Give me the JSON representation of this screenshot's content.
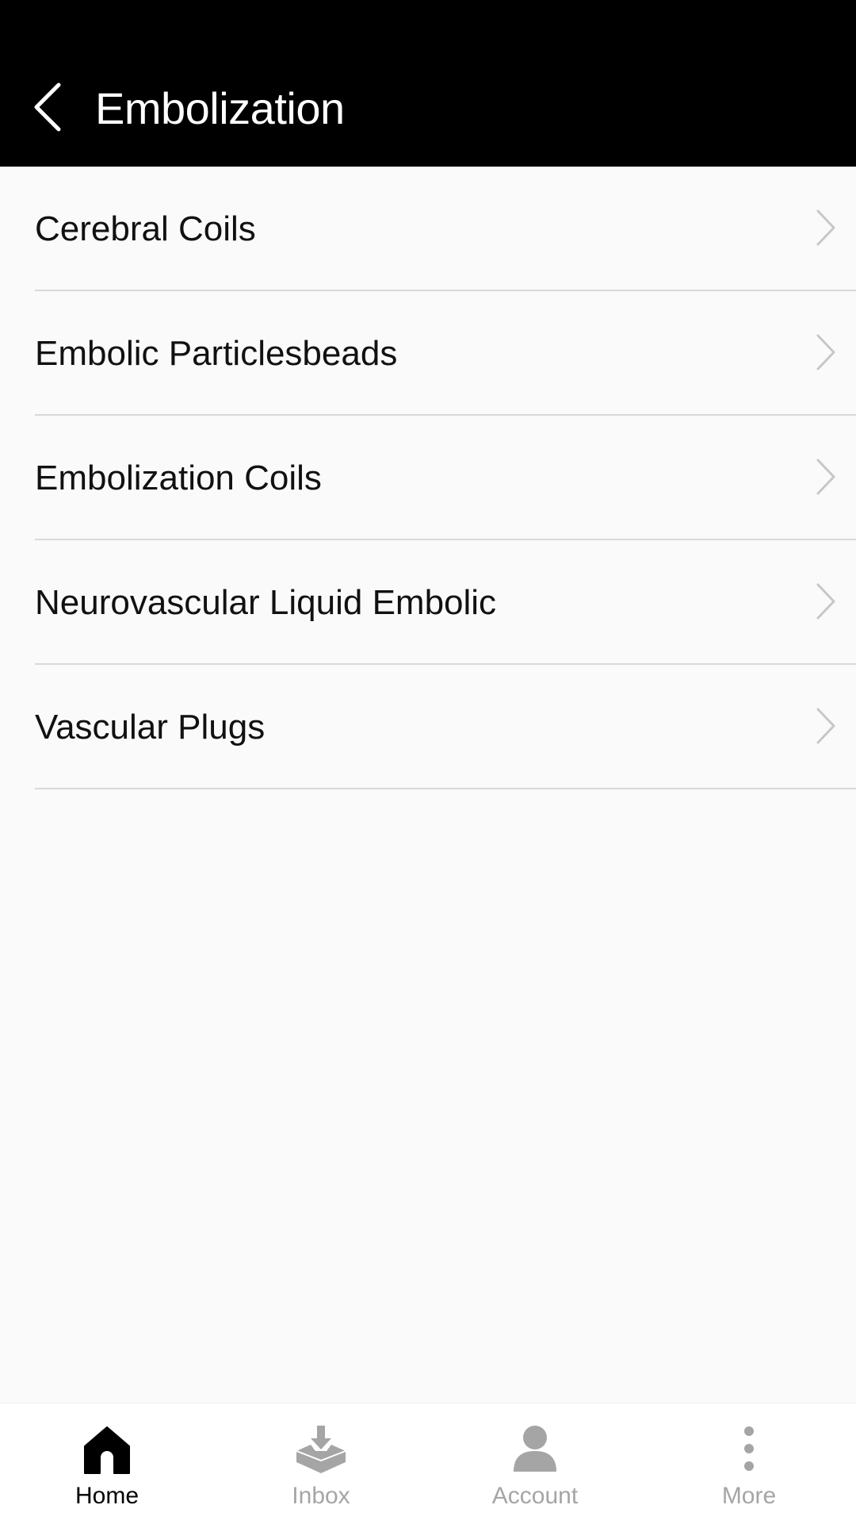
{
  "header": {
    "title": "Embolization",
    "back_icon": "chevron-left-icon"
  },
  "list": {
    "items": [
      {
        "label": "Cerebral Coils"
      },
      {
        "label": "Embolic Particlesbeads"
      },
      {
        "label": "Embolization Coils"
      },
      {
        "label": "Neurovascular Liquid Embolic"
      },
      {
        "label": "Vascular Plugs"
      }
    ],
    "chevron_icon": "chevron-right-icon"
  },
  "tabbar": {
    "tabs": [
      {
        "label": "Home",
        "icon": "home-icon",
        "active": true
      },
      {
        "label": "Inbox",
        "icon": "inbox-icon",
        "active": false
      },
      {
        "label": "Account",
        "icon": "account-icon",
        "active": false
      },
      {
        "label": "More",
        "icon": "more-icon",
        "active": false
      }
    ]
  },
  "colors": {
    "header_bg": "#000000",
    "background": "#fafafa",
    "active_tab": "#000000",
    "inactive_tab": "#a5a5a5",
    "divider": "#d8d8d8",
    "chevron": "#c7c7c7"
  }
}
